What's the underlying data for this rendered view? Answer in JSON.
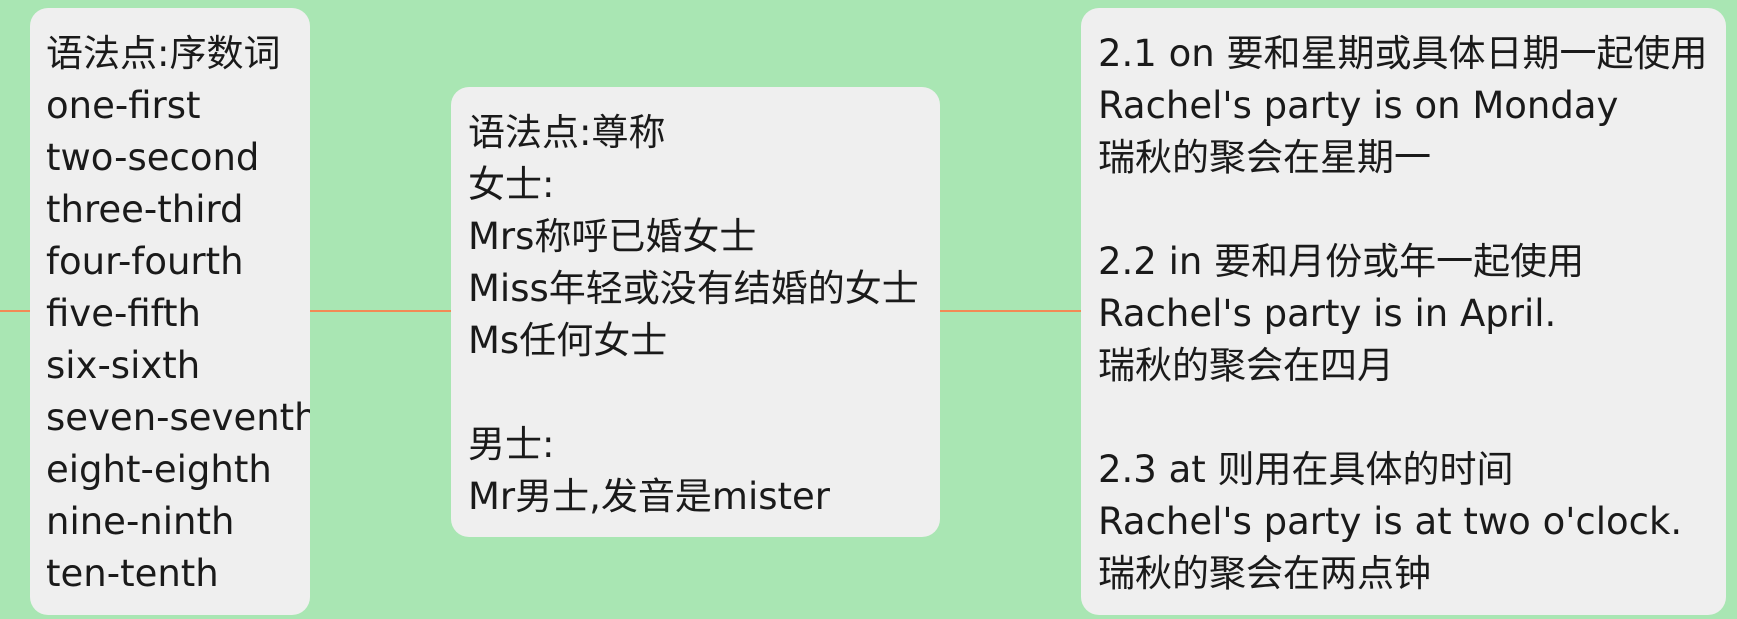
{
  "nodes": [
    {
      "id": "ordinal-numbers",
      "lines": [
        "语法点:序数词",
        "one-first",
        "two-second",
        "three-third",
        "four-fourth",
        "five-fifth",
        "six-sixth",
        "seven-seventh",
        "eight-eighth",
        "nine-ninth",
        "ten-tenth"
      ]
    },
    {
      "id": "titles-of-address",
      "lines": [
        "语法点:尊称",
        "女士:",
        "Mrs称呼已婚女士",
        "Miss年轻或没有结婚的女士",
        "Ms任何女士",
        "",
        "男士:",
        "Mr男士,发音是mister"
      ]
    },
    {
      "id": "time-prepositions",
      "lines": [
        "2.1 on 要和星期或具体日期一起使用",
        "Rachel's party is on Monday",
        "瑞秋的聚会在星期一",
        "",
        "2.2 in 要和月份或年一起使用",
        "Rachel's party is in April.",
        "瑞秋的聚会在四月",
        "",
        "2.3 at 则用在具体的时间",
        "Rachel's party is at two o'clock.",
        "瑞秋的聚会在两点钟"
      ]
    }
  ]
}
